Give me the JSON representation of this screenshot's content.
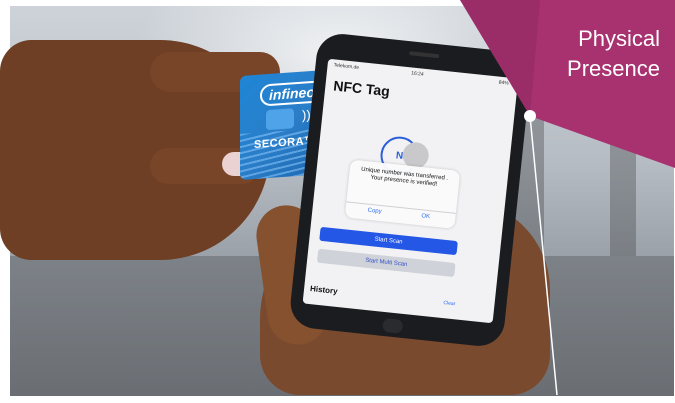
{
  "callout": {
    "label_line1": "Physical",
    "label_line2": "Presence",
    "color": "#a8316f"
  },
  "card": {
    "logo": "infineon",
    "nfc_symbol": "))))",
    "brand": "SECORA™ Pay",
    "color": "#1e86d6"
  },
  "phone": {
    "status_time": "16:24",
    "status_carrier": "Telekom.de",
    "status_battery": "84%",
    "nav_title": "NFC Tag",
    "nfc_icon": "nfc-icon",
    "alert_message": "Unique number was transferred . Your presence is verified!",
    "alert_copy": "Copy",
    "alert_ok": "OK",
    "start_scan": "Start Scan",
    "start_multi_scan": "Start Multi Scan",
    "history": "History",
    "clear": "Clear",
    "accent": "#2457e6"
  }
}
